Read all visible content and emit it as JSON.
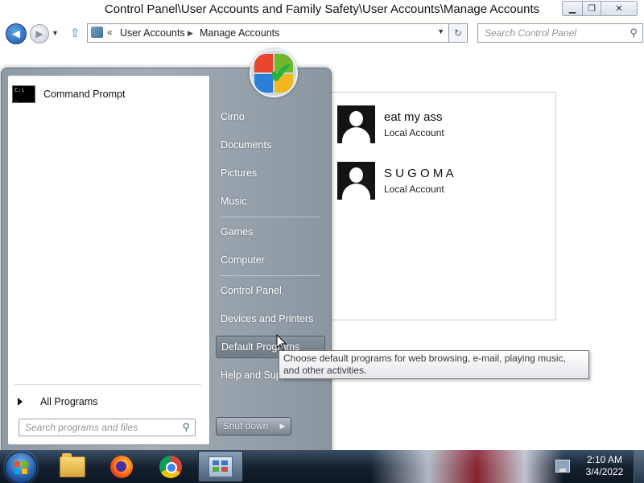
{
  "window": {
    "title": "Control Panel\\User Accounts and Family Safety\\User Accounts\\Manage Accounts",
    "controls": {
      "minimize": "minimize-icon",
      "maximize": "restore-icon",
      "close": "close-icon"
    }
  },
  "nav": {
    "breadcrumb": [
      "User Accounts",
      "Manage Accounts"
    ],
    "search_placeholder": "Search Control Panel"
  },
  "accounts": [
    {
      "name": "eat my ass",
      "type": "Local Account"
    },
    {
      "name": "S U G O M A",
      "type": "Local Account"
    }
  ],
  "start_menu": {
    "pinned_programs": [
      {
        "label": "Command Prompt",
        "icon": "command-prompt-icon"
      }
    ],
    "all_programs_label": "All Programs",
    "search_placeholder": "Search programs and files",
    "right_items": [
      {
        "label": "Cirno"
      },
      {
        "label": "Documents"
      },
      {
        "label": "Pictures"
      },
      {
        "label": "Music"
      },
      {
        "label": "Games"
      },
      {
        "label": "Computer"
      },
      {
        "label": "Control Panel"
      },
      {
        "label": "Devices and Printers"
      },
      {
        "label": "Default Programs",
        "highlighted": true
      },
      {
        "label": "Help and Support"
      }
    ],
    "shutdown_label": "Shut down"
  },
  "tooltip": {
    "text": "Choose default programs for web browsing, e-mail, playing music, and other activities."
  },
  "taskbar": {
    "pinned": [
      "folder-icon",
      "firefox-icon",
      "chrome-icon",
      "control-panel-icon"
    ],
    "active": "control-panel-icon",
    "time": "2:10 AM",
    "date": "3/4/2022"
  },
  "colors": {
    "start_menu": "#9aa5ad",
    "taskbar": "#14212f",
    "hover_item": "#7b868f"
  }
}
